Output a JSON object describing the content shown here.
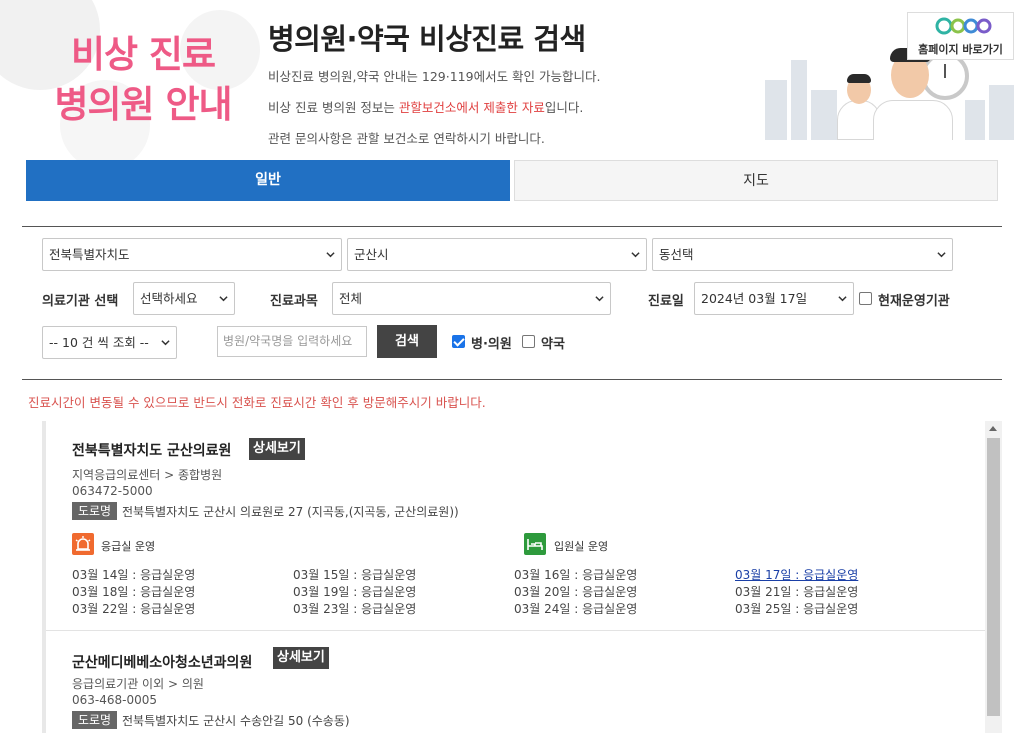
{
  "header": {
    "hero_line1": "비상 진료",
    "hero_line2": "병의원 안내",
    "title": "병의원·약국 비상진료 검색",
    "desc1": "비상진료 병의원,약국 안내는 129·119에서도 확인 가능합니다.",
    "desc2_prefix": "비상 진료 병의원 정보는 ",
    "desc2_highlight": "관할보건소에서 제출한 자료",
    "desc2_suffix": "입니다.",
    "desc3": "관련 문의사항은 관할 보건소로 연락하시기 바랍니다.",
    "homepage_label": "홈페이지 바로가기"
  },
  "tabs": [
    {
      "label": "일반",
      "active": true
    },
    {
      "label": "지도",
      "active": false
    }
  ],
  "filters": {
    "province": "전북특별자치도",
    "city": "군산시",
    "dong": "동선택",
    "facility_type_label": "의료기관 선택",
    "facility_type_value": "선택하세요",
    "department_label": "진료과목",
    "department_value": "전체",
    "date_label": "진료일",
    "date_value": "2024년 03월 17일",
    "open_now_label": "현재운영기관",
    "open_now_checked": false,
    "page_size": "-- 10 건 씩 조회 --",
    "search_placeholder": "병원/약국명을 입력하세요",
    "search_button": "검색",
    "hospital_label": "병·의원",
    "hospital_checked": true,
    "pharmacy_label": "약국",
    "pharmacy_checked": false
  },
  "notice": "진료시간이 변동될 수 있으므로 반드시 전화로 진료시간 확인 후 방문해주시기 바랍니다.",
  "results": [
    {
      "name": "전북특별자치도 군산의료원",
      "detail_label": "상세보기",
      "category": "지역응급의료센터 > 종합병원",
      "phone": "063472-5000",
      "road_tag": "도로명",
      "address": "전북특별자치도 군산시 의료원로 27 (지곡동,(지곡동, 군산의료원))",
      "er_label": "응급실 운영",
      "ward_label": "입원실 운영",
      "schedule": [
        "03월 14일 : 응급실운영",
        "03월 15일 : 응급실운영",
        "03월 16일 : 응급실운영",
        "03월 17일 : 응급실운영",
        "03월 18일 : 응급실운영",
        "03월 19일 : 응급실운영",
        "03월 20일 : 응급실운영",
        "03월 21일 : 응급실운영",
        "03월 22일 : 응급실운영",
        "03월 23일 : 응급실운영",
        "03월 24일 : 응급실운영",
        "03월 25일 : 응급실운영"
      ]
    },
    {
      "name": "군산메디베베소아청소년과의원",
      "detail_label": "상세보기",
      "category": "응급의료기관 이외 > 의원",
      "phone": "063-468-0005",
      "road_tag": "도로명",
      "address": "전북특별자치도 군산시 수송안길 50 (수송동)"
    }
  ],
  "colors": {
    "primary_blue": "#2170c3",
    "hero_pink": "#ee5a86",
    "notice_red": "#d9534f",
    "er_orange": "#f06a2f",
    "ward_green": "#2e9a3c"
  }
}
